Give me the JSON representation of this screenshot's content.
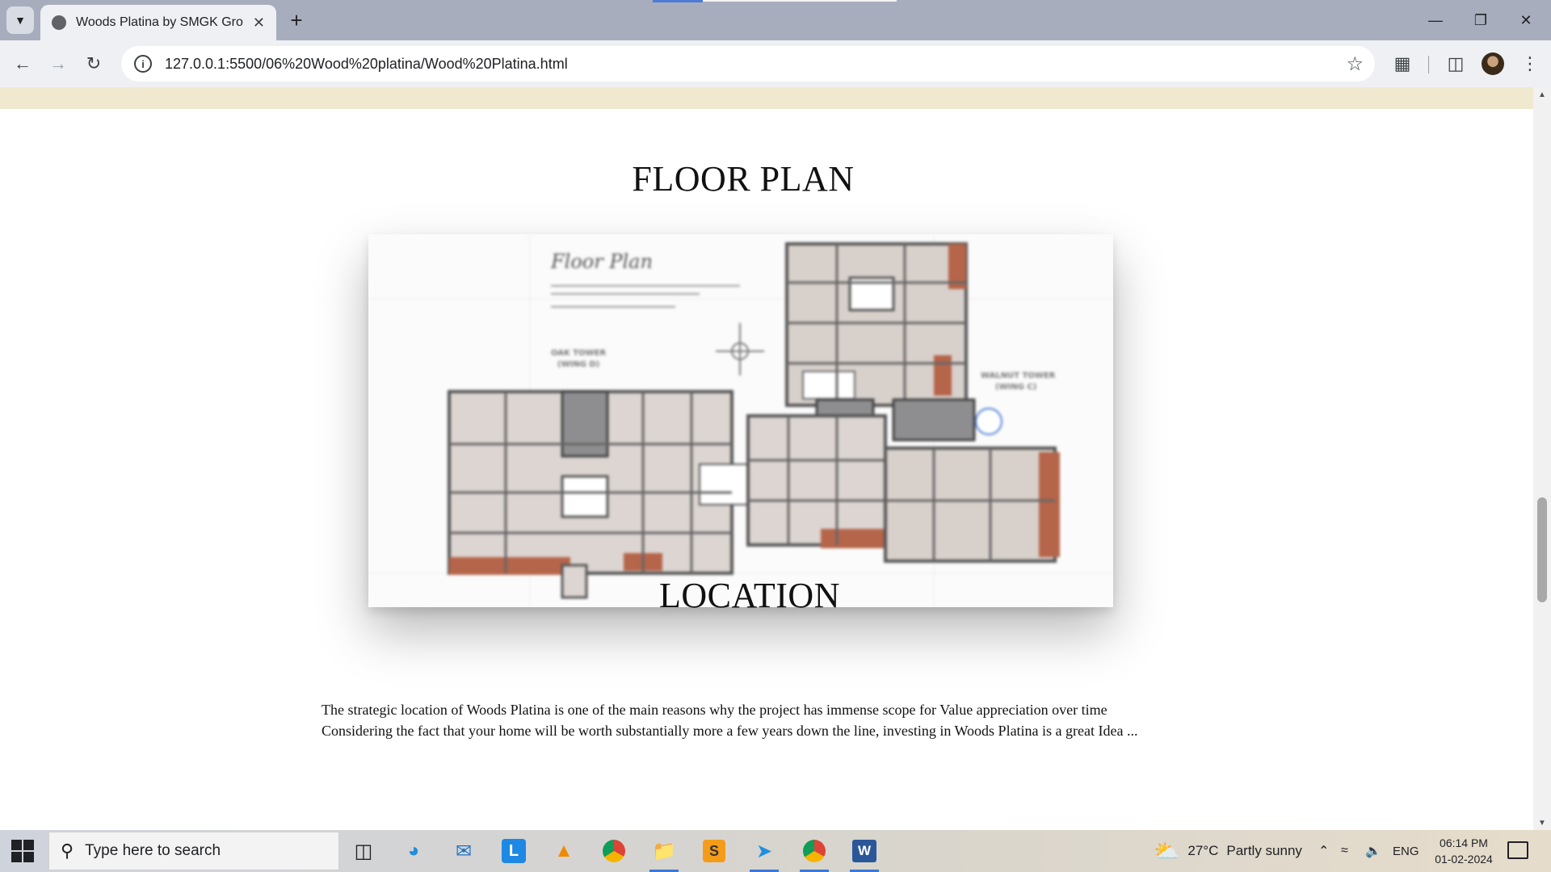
{
  "browser": {
    "tab_title": "Woods Platina by SMGK Group",
    "new_tab_label": "+",
    "url": "127.0.0.1:5500/06%20Wood%20platina/Wood%20Platina.html"
  },
  "page": {
    "floor_plan_heading": "FLOOR PLAN",
    "floor_plan_image": {
      "handwritten_title": "Floor Plan",
      "tower_label_left_1": "OAK TOWER",
      "tower_label_left_2": "(WING D)",
      "tower_label_right_1": "WALNUT TOWER",
      "tower_label_right_2": "(WING C)"
    },
    "location_heading": "LOCATION",
    "location_line_1": "The strategic location of Woods Platina is one of the main reasons why the project has immense scope for Value appreciation over time",
    "location_line_2": "Considering the fact that your home will be worth substantially more a few years down the line, investing in Woods Platina is a great Idea ..."
  },
  "taskbar": {
    "search_placeholder": "Type here to search",
    "weather_temp": "27°C",
    "weather_text": "Partly sunny",
    "language": "ENG",
    "time": "06:14 PM",
    "date": "01-02-2024",
    "apps": [
      "task-view",
      "edge",
      "mail",
      "l-app",
      "vlc",
      "chrome",
      "file-explorer",
      "sublime-text",
      "vscode",
      "chrome-profile",
      "word"
    ]
  },
  "colors": {
    "accent": "#3b78d8",
    "banner_strip": "#f0e9d0",
    "plan_terracotta": "#b5654a",
    "plan_room": "#ddd6d2",
    "plan_core": "#8e8e90"
  }
}
